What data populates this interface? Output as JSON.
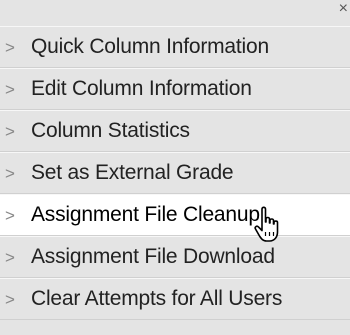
{
  "menu": {
    "close_label": "×",
    "chevron": ">",
    "items": [
      {
        "label": "Quick Column Information"
      },
      {
        "label": "Edit Column Information"
      },
      {
        "label": "Column Statistics"
      },
      {
        "label": "Set as External Grade"
      },
      {
        "label": "Assignment File Cleanup"
      },
      {
        "label": "Assignment File Download"
      },
      {
        "label": "Clear Attempts for All Users"
      }
    ],
    "hovered_item": "Assignment File Cleanup"
  },
  "cursor": {
    "type": "hand-pointer-icon"
  }
}
